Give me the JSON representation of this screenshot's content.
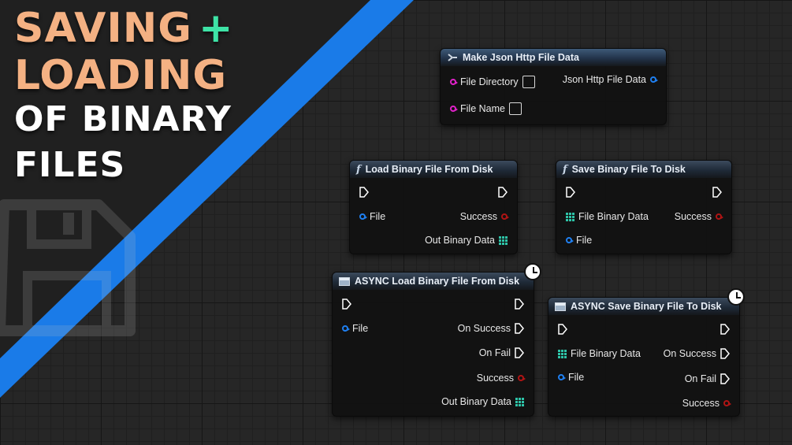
{
  "title": {
    "line1": "SAVING",
    "plus": "+",
    "line2": "LOADING",
    "line3": "OF BINARY",
    "line4": "FILES"
  },
  "colors": {
    "accent_orange": "#f4b183",
    "accent_green": "#3ee3a6",
    "stripe_blue": "#1a7be8",
    "pin_string": "#e022c8",
    "pin_object": "#1f7ff0",
    "pin_bool": "#b01414",
    "pin_binary": "#2ec4a8"
  },
  "nodes": {
    "make_json": {
      "title": "Make Json Http File Data",
      "pin_file_directory": "File Directory",
      "pin_file_name": "File Name",
      "pin_output": "Json Http File Data"
    },
    "load_binary": {
      "icon": "f",
      "title": "Load Binary File From Disk",
      "pin_file": "File",
      "pin_success": "Success",
      "pin_out_binary": "Out Binary Data"
    },
    "save_binary": {
      "icon": "f",
      "title": "Save Binary File To Disk",
      "pin_file_binary": "File Binary Data",
      "pin_file": "File",
      "pin_success": "Success"
    },
    "async_load": {
      "title": "ASYNC Load Binary File From Disk",
      "pin_file": "File",
      "pin_on_success": "On Success",
      "pin_on_fail": "On Fail",
      "pin_success": "Success",
      "pin_out_binary": "Out Binary Data"
    },
    "async_save": {
      "title": "ASYNC Save Binary File To Disk",
      "pin_file_binary": "File Binary Data",
      "pin_file": "File",
      "pin_on_success": "On Success",
      "pin_on_fail": "On Fail",
      "pin_success": "Success"
    }
  }
}
